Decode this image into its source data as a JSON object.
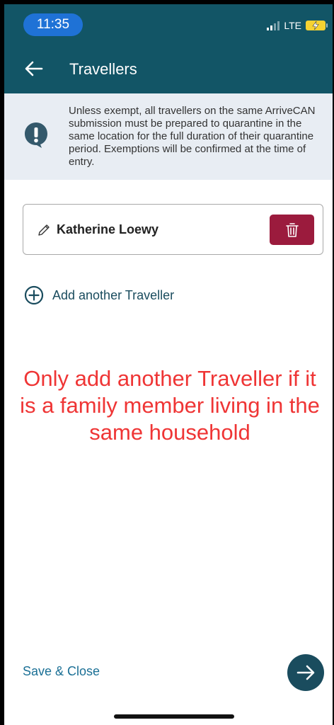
{
  "status_bar": {
    "time": "11:35",
    "network": "LTE"
  },
  "app_bar": {
    "title": "Travellers",
    "back_icon": "arrow-left-icon"
  },
  "info_banner": {
    "icon": "exclamation-icon",
    "text": "Unless exempt, all travellers on the same ArriveCAN submission must be prepared to quarantine in the same location for the full duration of their quarantine period. Exemptions will be confirmed at the time of entry."
  },
  "travellers": [
    {
      "name": "Katherine Loewy",
      "edit_icon": "pencil-icon",
      "delete_icon": "trash-icon"
    }
  ],
  "add_traveller": {
    "label": "Add another Traveller",
    "icon": "plus-circle-icon"
  },
  "annotation": {
    "text": "Only add another Traveller if it is a family member living in the same household"
  },
  "footer": {
    "save_close_label": "Save & Close",
    "next_icon": "arrow-right-icon"
  },
  "colors": {
    "header": "#125566",
    "banner": "#e8edf3",
    "delete": "#9b1b3d",
    "accent": "#1a4c5e",
    "link": "#1a6f95",
    "annotation": "#ef3535"
  }
}
